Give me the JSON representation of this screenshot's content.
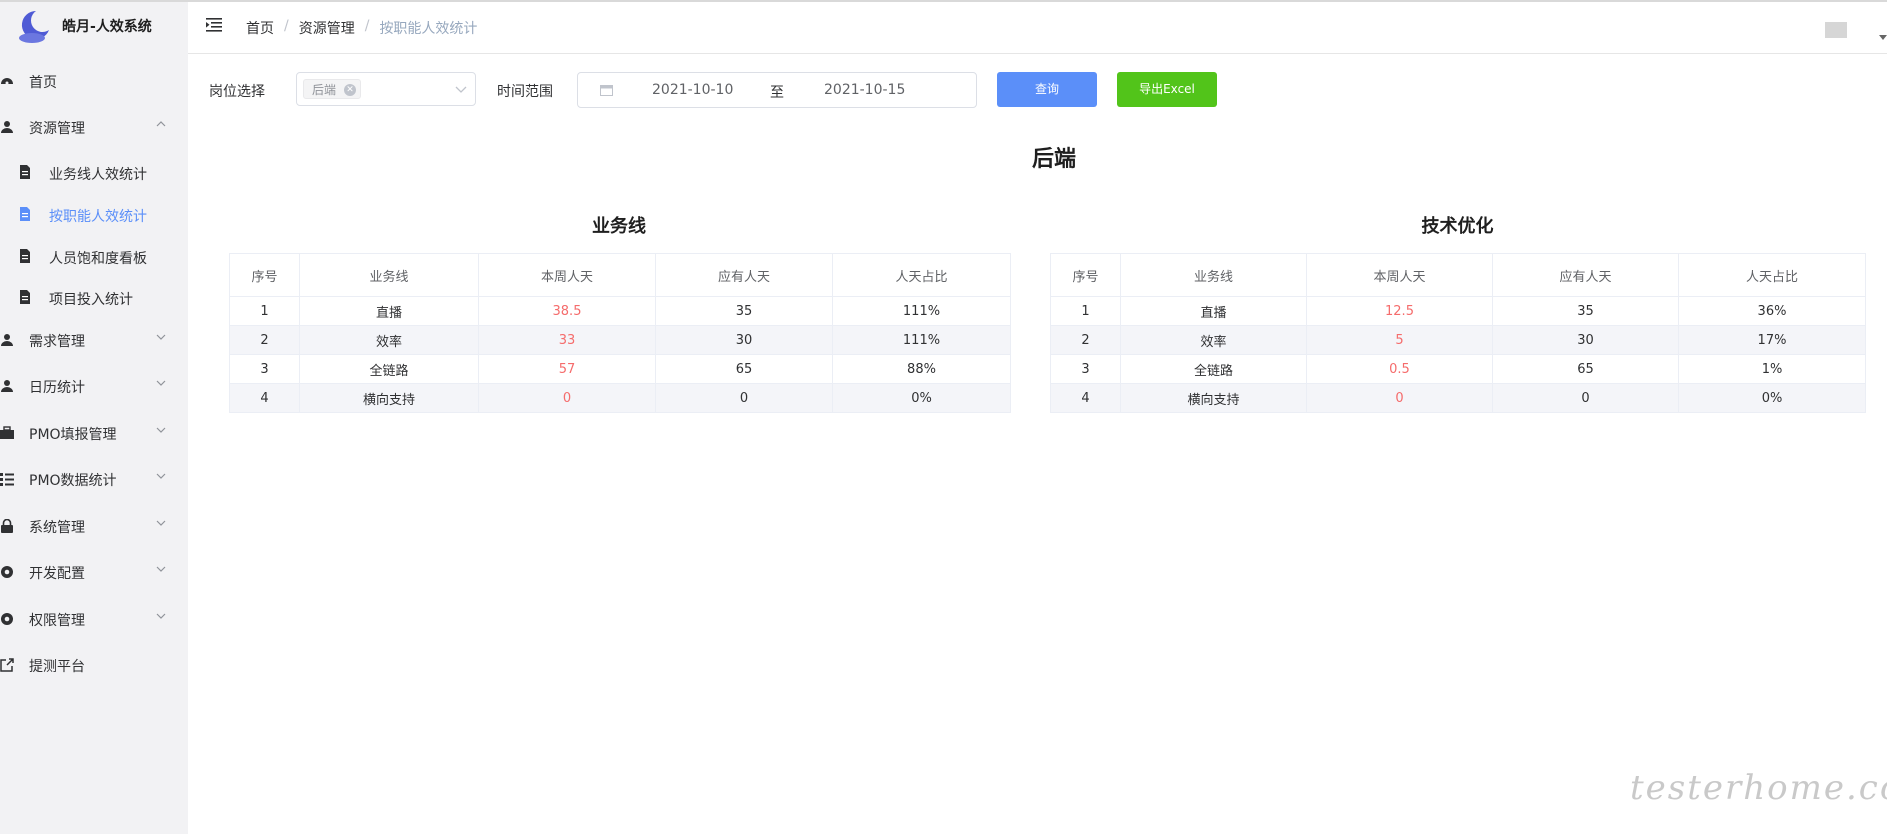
{
  "app": {
    "title": "皓月-人效系统"
  },
  "sidebar": {
    "items": [
      {
        "label": "首页",
        "icon": "dashboard-icon"
      },
      {
        "label": "资源管理",
        "icon": "user-icon",
        "expanded": true
      },
      {
        "label": "需求管理",
        "icon": "user-icon"
      },
      {
        "label": "日历统计",
        "icon": "user-icon"
      },
      {
        "label": "PMO填报管理",
        "icon": "briefcase-icon"
      },
      {
        "label": "PMO数据统计",
        "icon": "list-icon"
      },
      {
        "label": "系统管理",
        "icon": "lock-icon"
      },
      {
        "label": "开发配置",
        "icon": "gear-icon"
      },
      {
        "label": "权限管理",
        "icon": "gear-icon"
      },
      {
        "label": "提测平台",
        "icon": "external-link-icon"
      }
    ],
    "subitems": [
      {
        "label": "业务线人效统计",
        "icon": "document-icon"
      },
      {
        "label": "按职能人效统计",
        "icon": "document-icon",
        "active": true
      },
      {
        "label": "人员饱和度看板",
        "icon": "document-icon"
      },
      {
        "label": "项目投入统计",
        "icon": "document-icon"
      }
    ]
  },
  "breadcrumb": [
    "首页",
    "资源管理",
    "按职能人效统计"
  ],
  "filters": {
    "position_label": "岗位选择",
    "position_tag": "后端",
    "time_label": "时间范围",
    "start_date": "2021-10-10",
    "range_separator": "至",
    "end_date": "2021-10-15",
    "query_button": "查询",
    "export_button": "导出Excel"
  },
  "content": {
    "title": "后端",
    "tables": [
      {
        "title": "业务线",
        "headers": [
          "序号",
          "业务线",
          "本周人天",
          "应有人天",
          "人天占比"
        ],
        "rows": [
          [
            "1",
            "直播",
            "38.5",
            "35",
            "111%"
          ],
          [
            "2",
            "效率",
            "33",
            "30",
            "111%"
          ],
          [
            "3",
            "全链路",
            "57",
            "65",
            "88%"
          ],
          [
            "4",
            "横向支持",
            "0",
            "0",
            "0%"
          ]
        ]
      },
      {
        "title": "技术优化",
        "headers": [
          "序号",
          "业务线",
          "本周人天",
          "应有人天",
          "人天占比"
        ],
        "rows": [
          [
            "1",
            "直播",
            "12.5",
            "35",
            "36%"
          ],
          [
            "2",
            "效率",
            "5",
            "30",
            "17%"
          ],
          [
            "3",
            "全链路",
            "0.5",
            "65",
            "1%"
          ],
          [
            "4",
            "横向支持",
            "0",
            "0",
            "0%"
          ]
        ]
      }
    ]
  },
  "watermark": "testerhome.com",
  "colors": {
    "accent": "#5b8ff9",
    "export": "#52c41a",
    "highlight": "#f56c6c"
  }
}
